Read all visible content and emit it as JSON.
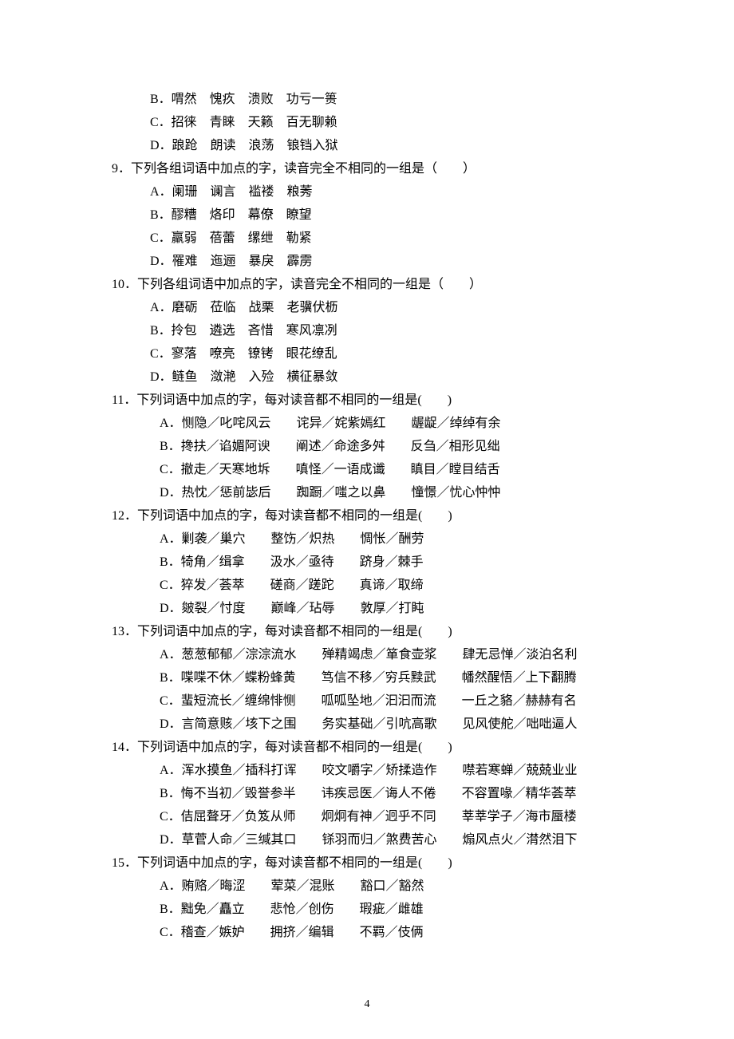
{
  "page_number": "4",
  "pre_options": [
    "B．喟然　愧疚　溃败　功亏一篑",
    "C．招徕　青睐　天籁　百无聊赖",
    "D．踉跄　朗读　浪荡　锒铛入狱"
  ],
  "questions": [
    {
      "stem": "9．下列各组词语中加点的字，读音完全不相同的一组是（　　）",
      "opts": [
        "A．阑珊　谰言　褴褛　粮莠",
        "B．醪糟　烙印　幕僚　瞭望",
        "C．羸弱　蓓蕾　缧绁　勒紧",
        "D．罹难　迤逦　暴戾　霹雳"
      ]
    },
    {
      "stem": "10．下列各组词语中加点的字，读音完全不相同的一组是（　　）",
      "opts": [
        "A．磨砺　莅临　战栗　老骥伏枥",
        "B．拎包　遴选　吝惜　寒风凛冽",
        "C．寥落　嘹亮　镣铐　眼花缭乱",
        "D．鲢鱼　潋滟　入殓　横征暴敛"
      ]
    },
    {
      "stem": "11．下列词语中加点的字，每对读音都不相同的一组是(　　)",
      "opts": [
        "A．恻隐／叱咤风云　　诧异／姹紫嫣红　　龌龊／绰绰有余",
        "B．搀扶／谄媚阿谀　　阐述／命途多舛　　反刍／相形见绌",
        "C．撤走／天寒地坼　　嗔怪／一语成谶　　瞋目／瞠目结舌",
        "D．热忱／惩前毖后　　踟蹰／嗤之以鼻　　憧憬／忧心忡忡"
      ]
    },
    {
      "stem": "12．下列词语中加点的字，每对读音都不相同的一组是(　　)",
      "opts": [
        "A．剿袭／巢穴　　整饬／炽热　　惆怅／酬劳",
        "B．犄角／缉拿　　汲水／亟待　　跻身／棘手",
        "C．猝发／荟萃　　磋商／蹉跎　　真谛／取缔",
        "D．皴裂／忖度　　巅峰／玷辱　　敦厚／打盹"
      ]
    },
    {
      "stem": "13．下列词语中加点的字，每对读音都不相同的一组是(　　)",
      "opts": [
        "A．葱葱郁郁／淙淙流水　　殚精竭虑／箪食壶浆　　肆无忌惮／淡泊名利",
        "B．喋喋不休／蝶粉蜂黄　　笃信不移／穷兵黩武　　幡然醒悟／上下翻腾",
        "C．蜚短流长／缠绵悱恻　　呱呱坠地／汩汩而流　　一丘之貉／赫赫有名",
        "D．言简意赅／垓下之围　　务实基础／引吭高歌　　见风使舵／咄咄逼人"
      ]
    },
    {
      "stem": "14．下列词语中加点的字，每对读音都不相同的一组是(　　)",
      "opts": [
        "A．浑水摸鱼／插科打诨　　咬文嚼字／矫揉造作　　噤若寒蝉／兢兢业业",
        "B．悔不当初／毁誉参半　　讳疾忌医／诲人不倦　　不容置喙／精华荟萃",
        "C．佶屈聱牙／负笈从师　　炯炯有神／迥乎不同　　莘莘学子／海市蜃楼",
        "D．草菅人命／三缄其口　　铩羽而归／煞费苦心　　煽风点火／潸然泪下"
      ]
    },
    {
      "stem": "15．下列词语中加点的字，每对读音都不相同的一组是(　　)",
      "opts": [
        "A．贿赂／晦涩　　荤菜／混账　　豁口／豁然",
        "B．黜免／矗立　　悲怆／创伤　　瑕疵／雌雄",
        "C．稽查／嫉妒　　拥挤／编辑　　不羁／伎俩"
      ]
    }
  ]
}
